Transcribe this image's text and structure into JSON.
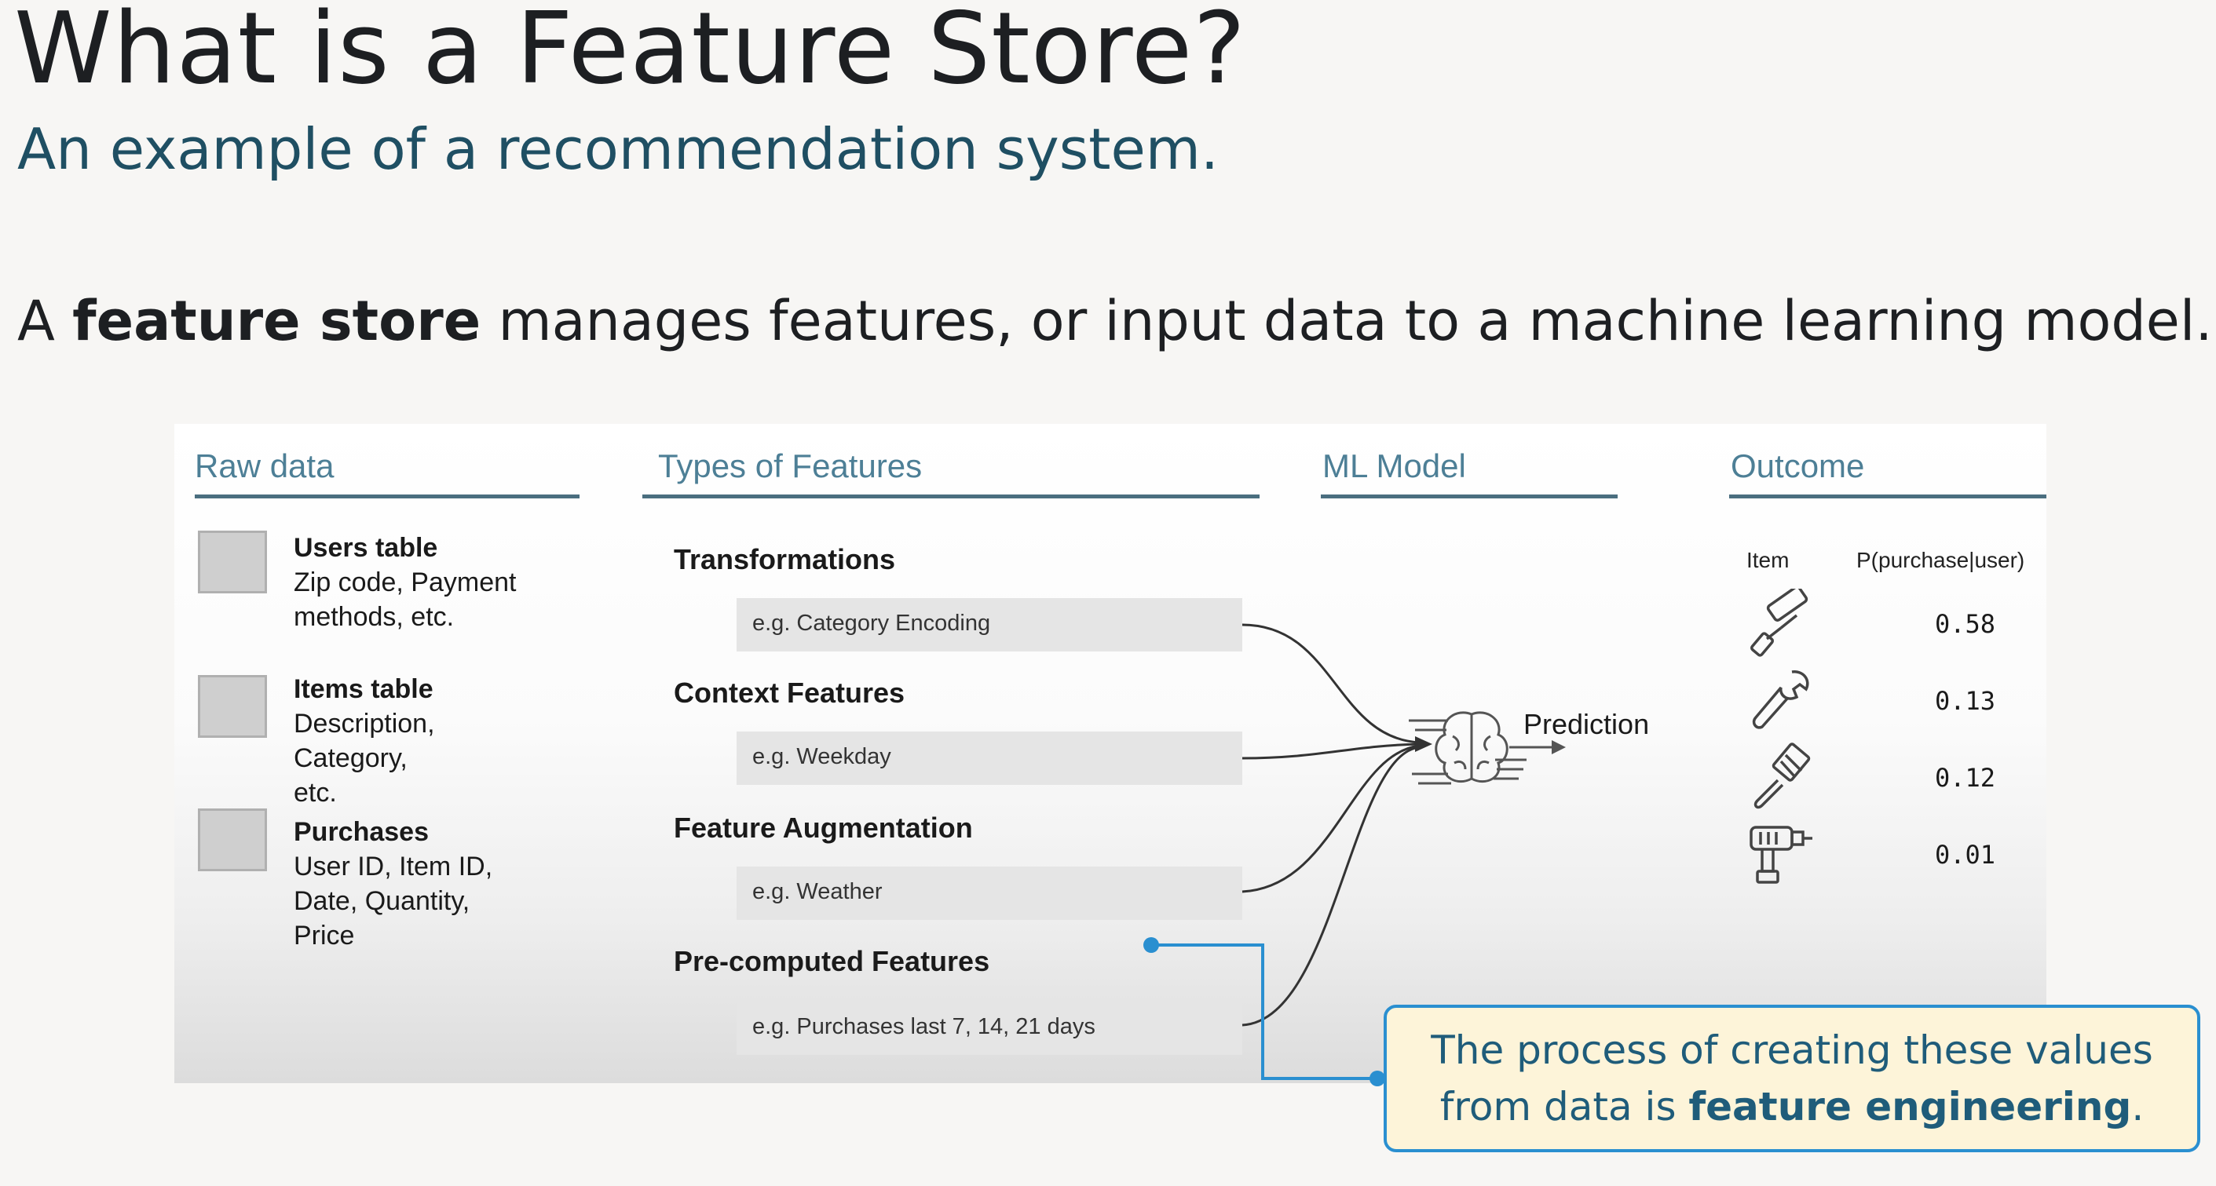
{
  "title": "What is a Feature Store?",
  "subtitle": "An example of a recommendation system.",
  "lead": {
    "prefix": "A ",
    "bold": "feature store",
    "suffix": " manages features, or input data to a machine learning model."
  },
  "columns": {
    "raw": "Raw data",
    "features": "Types of Features",
    "model": "ML Model",
    "outcome": "Outcome"
  },
  "raw_tables": [
    {
      "name": "Users table",
      "desc": [
        "Zip code, Payment",
        "methods, etc."
      ]
    },
    {
      "name": "Items table",
      "desc": [
        "Description,",
        "Category,",
        "etc."
      ]
    },
    {
      "name": "Purchases",
      "desc": [
        "User ID, Item ID,",
        "Date, Quantity,",
        "Price"
      ]
    }
  ],
  "feature_types": [
    {
      "title": "Transformations",
      "example": "e.g. Category Encoding"
    },
    {
      "title": "Context Features",
      "example": "e.g. Weekday"
    },
    {
      "title": "Feature Augmentation",
      "example": "e.g. Weather"
    },
    {
      "title": "Pre-computed Features",
      "example": "e.g. Purchases last 7, 14, 21 days"
    }
  ],
  "model": {
    "prediction_label": "Prediction",
    "icon": "brain-icon"
  },
  "outcome": {
    "item_header": "Item",
    "prob_header": "P(purchase|user)",
    "rows": [
      {
        "icon": "paint-roller-icon",
        "value": "0.58"
      },
      {
        "icon": "wrench-icon",
        "value": "0.13"
      },
      {
        "icon": "paint-brush-icon",
        "value": "0.12"
      },
      {
        "icon": "power-drill-icon",
        "value": "0.01"
      }
    ]
  },
  "callout": {
    "line1": "The process of creating these values",
    "line2_prefix": "from data is ",
    "line2_bold": "feature engineering",
    "line2_suffix": "."
  },
  "colors": {
    "accent_blue": "#2a8fd0",
    "heading_teal": "#1f4f63",
    "callout_bg": "#fdf4d9"
  }
}
